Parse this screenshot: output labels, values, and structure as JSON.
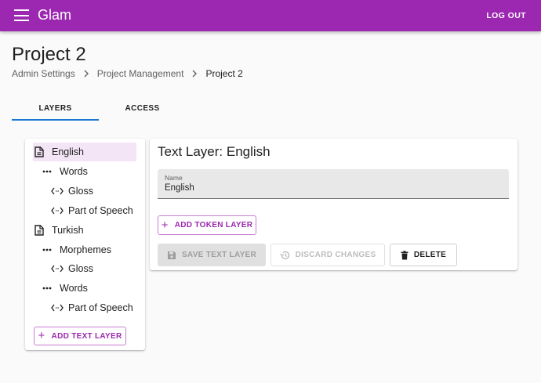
{
  "app": {
    "title": "Glam",
    "logout_label": "LOG OUT"
  },
  "page": {
    "title": "Project 2"
  },
  "breadcrumb": {
    "items": [
      "Admin Settings",
      "Project Management",
      "Project 2"
    ]
  },
  "tabs": [
    {
      "label": "LAYERS",
      "active": true
    },
    {
      "label": "ACCESS",
      "active": false
    }
  ],
  "tree": {
    "items": [
      {
        "label": "English",
        "icon": "document-icon",
        "selected": true
      },
      {
        "label": "Words",
        "icon": "ellipsis-icon"
      },
      {
        "label": "Gloss",
        "icon": "code-icon"
      },
      {
        "label": "Part of Speech",
        "icon": "code-icon"
      },
      {
        "label": "Turkish",
        "icon": "document-icon"
      },
      {
        "label": "Morphemes",
        "icon": "ellipsis-icon"
      },
      {
        "label": "Gloss",
        "icon": "code-icon"
      },
      {
        "label": "Words",
        "icon": "ellipsis-icon"
      },
      {
        "label": "Part of Speech",
        "icon": "code-icon"
      }
    ],
    "add_label": "ADD TEXT LAYER"
  },
  "detail": {
    "title": "Text Layer: English",
    "name_label": "Name",
    "name_value": "English",
    "add_token_label": "ADD TOKEN LAYER",
    "save_label": "SAVE TEXT LAYER",
    "discard_label": "DISCARD CHANGES",
    "delete_label": "DELETE"
  },
  "colors": {
    "primary": "#9c27b0",
    "tab_indicator": "#1976d2",
    "selected_bg": "#f3e5f5"
  }
}
